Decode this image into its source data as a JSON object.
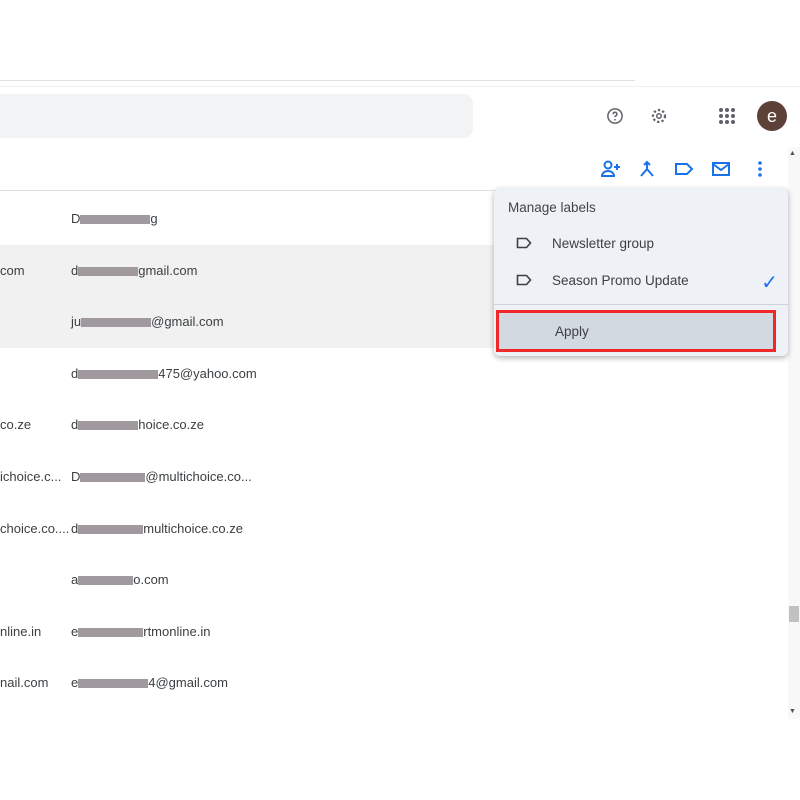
{
  "header": {
    "search_placeholder": "",
    "avatar_letter": "e",
    "icons": [
      "help-icon",
      "settings-icon",
      "apps-icon"
    ]
  },
  "toolbar": {
    "icons": [
      "add-contact-icon",
      "merge-icon",
      "label-icon",
      "email-icon",
      "more-vert-icon"
    ]
  },
  "rows": [
    {
      "col1": "",
      "col2_prefix": "D",
      "col2_suffix": "g",
      "selected": false
    },
    {
      "col1": "com",
      "col2_prefix": "d",
      "col2_suffix": "gmail.com",
      "selected": true
    },
    {
      "col1": "",
      "col2_prefix": "ju",
      "col2_suffix": "@gmail.com",
      "selected": true
    },
    {
      "col1": "",
      "col2_prefix": "d",
      "col2_suffix": "475@yahoo.com",
      "selected": false
    },
    {
      "col1": "co.ze",
      "col2_prefix": "d",
      "col2_suffix": "hoice.co.ze",
      "selected": false
    },
    {
      "col1": "ichoice.c...",
      "col2_prefix": "D",
      "col2_suffix": "@multichoice.co...",
      "selected": false
    },
    {
      "col1": "choice.co....",
      "col2_prefix": "d",
      "col2_suffix": "multichoice.co.ze",
      "selected": false
    },
    {
      "col1": "",
      "col2_prefix": "a",
      "col2_suffix": "o.com",
      "selected": false
    },
    {
      "col1": "nline.in",
      "col2_prefix": "e",
      "col2_suffix": "rtmonline.in",
      "selected": false
    },
    {
      "col1": "nail.com",
      "col2_prefix": "e",
      "col2_suffix": "4@gmail.com",
      "selected": false
    }
  ],
  "menu": {
    "title": "Manage labels",
    "items": [
      {
        "label": "Newsletter group",
        "checked": false
      },
      {
        "label": "Season Promo Update",
        "checked": true
      }
    ],
    "apply_label": "Apply",
    "check_glyph": "✓"
  },
  "colors": {
    "accent": "#1a73e8",
    "highlight_box": "#f0282a",
    "avatar": "#5d4037"
  }
}
